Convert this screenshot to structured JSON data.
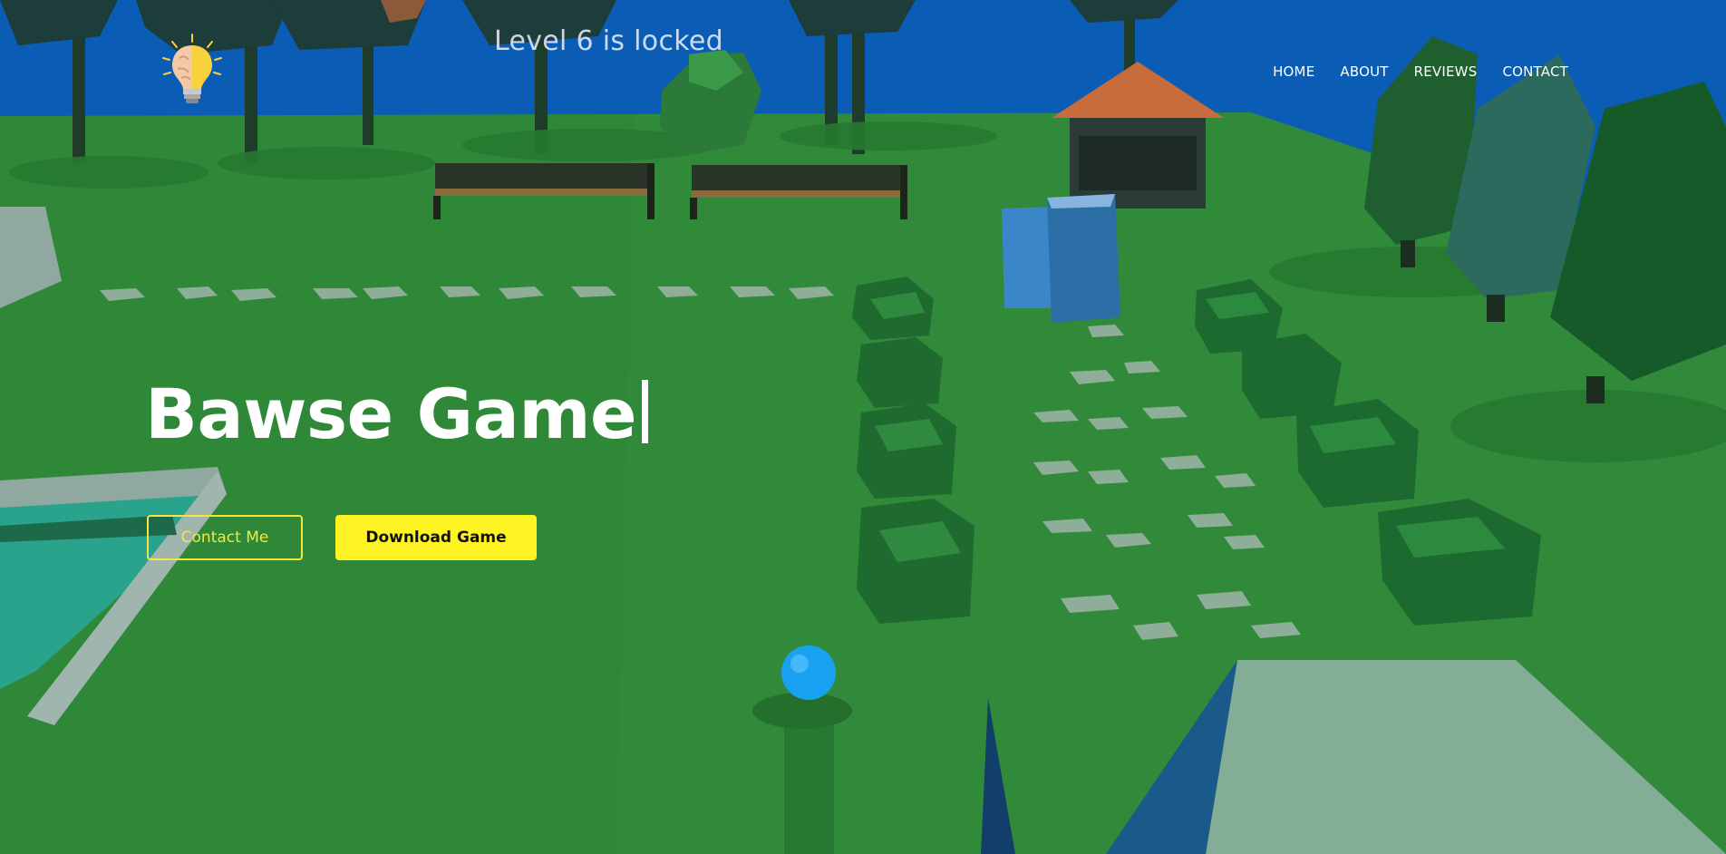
{
  "game_overlay": {
    "status": "Level 6 is locked"
  },
  "brand": {
    "logo_icon": "lightbulb-brain-icon"
  },
  "nav": {
    "items": [
      "HOME",
      "ABOUT",
      "REVIEWS",
      "CONTACT"
    ]
  },
  "hero": {
    "title": "Bawse Game",
    "contact_label": "Contact Me",
    "download_label": "Download Game"
  },
  "colors": {
    "sky": "#0a5bb4",
    "grass": "#2f8a37",
    "accent_yellow": "#fff423",
    "outline_yellow": "#f5e63b",
    "ball": "#1ea0f0"
  }
}
